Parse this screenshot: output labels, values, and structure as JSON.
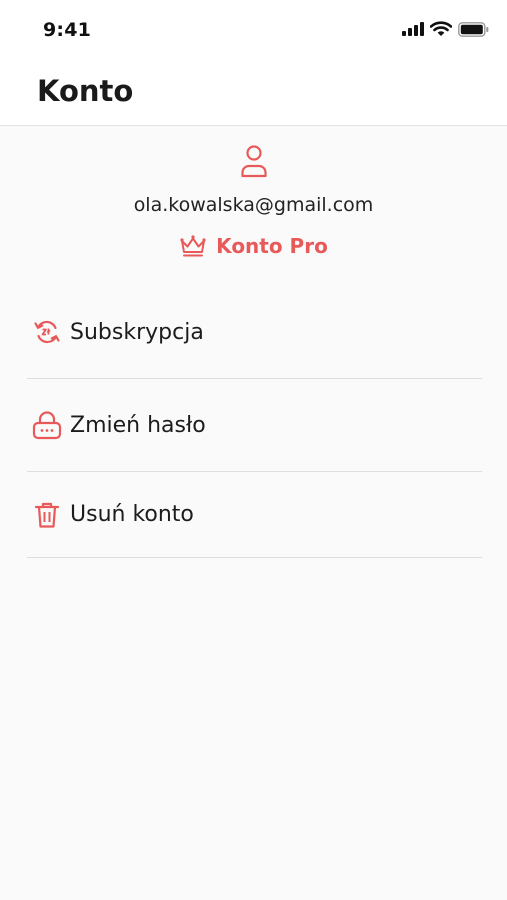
{
  "status_bar": {
    "time": "9:41",
    "icons": [
      "signal-icon",
      "wifi-icon",
      "battery-icon"
    ]
  },
  "header": {
    "title": "Konto"
  },
  "profile": {
    "avatar_icon": "user-icon",
    "email": "ola.kowalska@gmail.com",
    "plan_icon": "crown-icon",
    "plan_label": "Konto Pro"
  },
  "menu": {
    "items": [
      {
        "label": "Subskrypcja",
        "icon": "subscription-renew-icon"
      },
      {
        "label": "Zmień hasło",
        "icon": "lock-password-icon"
      },
      {
        "label": "Usuń konto",
        "icon": "trash-icon"
      }
    ]
  },
  "colors": {
    "accent": "#e85a5a",
    "background": "#fafafa",
    "divider": "#dedede"
  }
}
